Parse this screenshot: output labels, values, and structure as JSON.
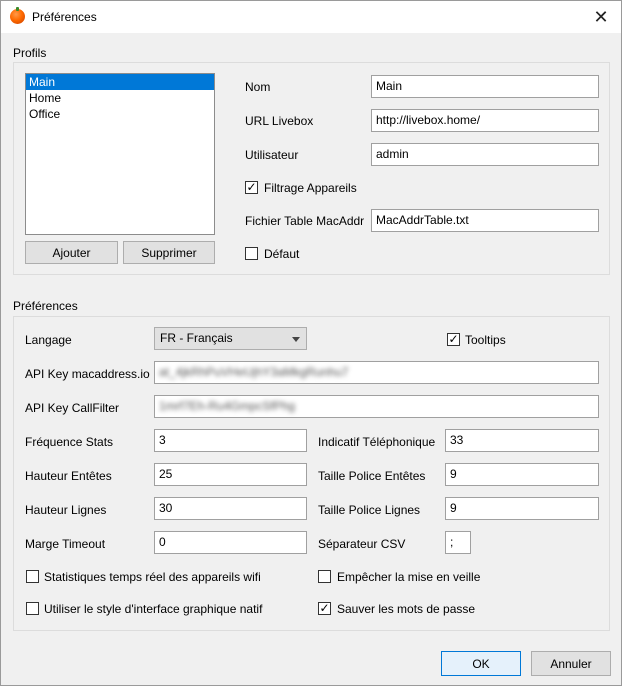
{
  "window": {
    "title": "Préférences",
    "close_glyph": "✕",
    "icon": "orange-app-icon"
  },
  "profiles": {
    "group_title": "Profils",
    "items": [
      "Main",
      "Home",
      "Office"
    ],
    "selected": "Main",
    "add_button": "Ajouter",
    "delete_button": "Supprimer",
    "fields": {
      "name": {
        "label": "Nom",
        "value": "Main"
      },
      "url": {
        "label": "URL Livebox",
        "value": "http://livebox.home/"
      },
      "user": {
        "label": "Utilisateur",
        "value": "admin"
      },
      "device_filter": {
        "label": "Filtrage Appareils",
        "checked": true
      },
      "macaddr_file": {
        "label": "Fichier Table MacAddr",
        "value": "MacAddrTable.txt"
      },
      "default": {
        "label": "Défaut",
        "checked": false
      }
    }
  },
  "preferences": {
    "group_title": "Préférences",
    "language": {
      "label": "Langage",
      "value": "FR - Français"
    },
    "tooltips": {
      "label": "Tooltips",
      "checked": true
    },
    "api_key_macaddress": {
      "label": "API Key macaddress.io",
      "value": "at_4jkRhPuVHeUjhY3aMkgRunhu7"
    },
    "api_key_callfilter": {
      "label": "API Key CallFilter",
      "value": "1mrf7Eh-Ru4GmpcSfPhg"
    },
    "stats_frequency": {
      "label": "Fréquence Stats",
      "value": "3"
    },
    "phone_prefix": {
      "label": "Indicatif Téléphonique",
      "value": "33"
    },
    "header_height": {
      "label": "Hauteur Entêtes",
      "value": "25"
    },
    "header_font_size": {
      "label": "Taille Police Entêtes",
      "value": "9"
    },
    "row_height": {
      "label": "Hauteur Lignes",
      "value": "30"
    },
    "row_font_size": {
      "label": "Taille Police Lignes",
      "value": "9"
    },
    "timeout_margin": {
      "label": "Marge Timeout",
      "value": "0"
    },
    "csv_separator": {
      "label": "Séparateur CSV",
      "value": ";"
    },
    "realtime_stats": {
      "label": "Statistiques temps réel des appareils wifi",
      "checked": false
    },
    "prevent_sleep": {
      "label": "Empêcher la mise en veille",
      "checked": false
    },
    "native_style": {
      "label": "Utiliser le style d'interface graphique natif",
      "checked": false
    },
    "save_passwords": {
      "label": "Sauver les mots de passe",
      "checked": true
    }
  },
  "footer": {
    "ok_button": "OK",
    "cancel_button": "Annuler"
  },
  "glyphs": {
    "check": "✓"
  }
}
